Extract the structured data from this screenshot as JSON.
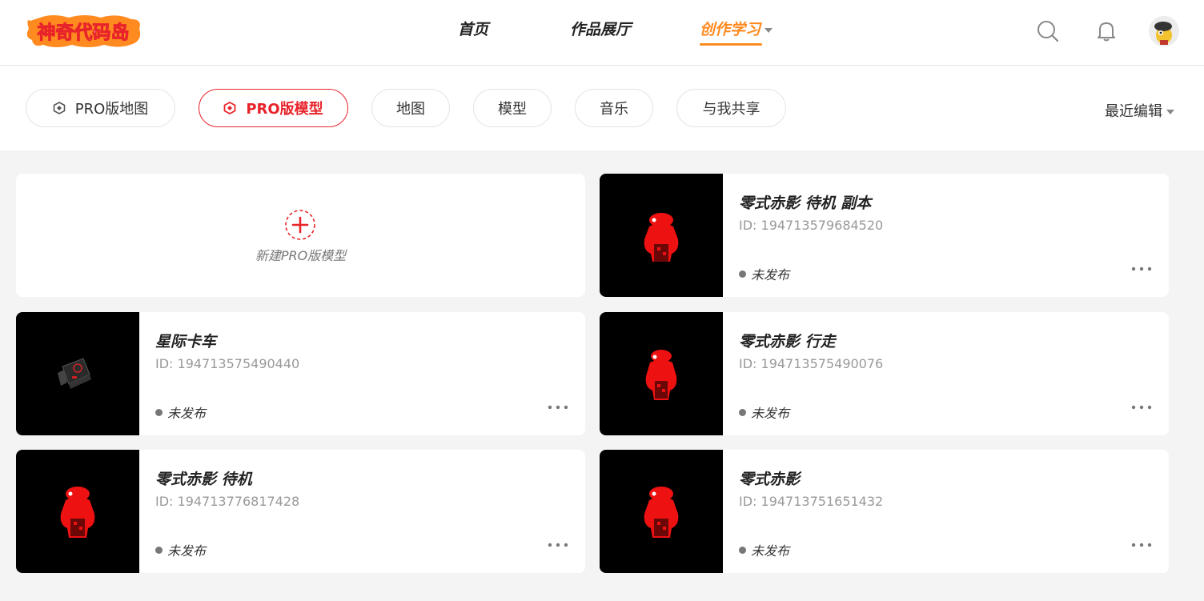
{
  "header": {
    "logo_text": "神奇代码岛",
    "nav": [
      {
        "label": "首页"
      },
      {
        "label": "作品展厅"
      },
      {
        "label": "创作学习"
      }
    ]
  },
  "filters": {
    "chips": [
      {
        "label": "PRO版地图"
      },
      {
        "label": "PRO版模型"
      },
      {
        "label": "地图"
      },
      {
        "label": "模型"
      },
      {
        "label": "音乐"
      },
      {
        "label": "与我共享"
      }
    ],
    "sort_label": "最近编辑"
  },
  "new_card": {
    "label": "新建PRO版模型"
  },
  "cards": [
    {
      "title": "零式赤影 待机 副本",
      "id": "ID: 194713579684520",
      "status": "未发布"
    },
    {
      "title": "星际卡车",
      "id": "ID: 194713575490440",
      "status": "未发布"
    },
    {
      "title": "零式赤影 行走",
      "id": "ID: 194713575490076",
      "status": "未发布"
    },
    {
      "title": "零式赤影 待机",
      "id": "ID: 194713776817428",
      "status": "未发布"
    },
    {
      "title": "零式赤影",
      "id": "ID: 194713751651432",
      "status": "未发布"
    }
  ],
  "colors": {
    "accent": "#ff8a1f",
    "active_red": "#e8232a",
    "status_dot": "#777777"
  }
}
